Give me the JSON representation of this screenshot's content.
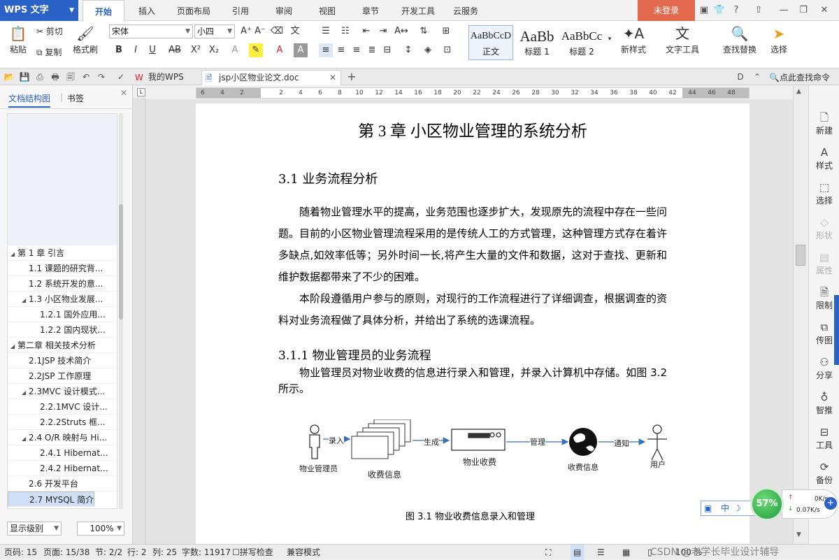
{
  "app": {
    "logo": "WPS 文字",
    "menu_tabs": [
      "开始",
      "插入",
      "页面布局",
      "引用",
      "审阅",
      "视图",
      "章节",
      "开发工具",
      "云服务"
    ],
    "active_tab": "开始",
    "login": "未登录"
  },
  "ribbon": {
    "paste": "粘贴",
    "cut": "剪切",
    "copy": "复制",
    "format_painter": "格式刷",
    "font_name": "宋体",
    "font_size": "小四",
    "styles": [
      {
        "sample": "AaBbCcD",
        "label": "正文"
      },
      {
        "sample": "AaBb",
        "label": "标题 1"
      },
      {
        "sample": "AaBbCc",
        "label": "标题 2"
      }
    ],
    "new_style": "新样式",
    "text_tools": "文字工具",
    "find_replace": "查找替换",
    "select": "选择"
  },
  "tabs": {
    "home_tab": "我的WPS",
    "doc_tab": "jsp小区物业论文.doc",
    "search_cmd": "点此查找命令"
  },
  "nav": {
    "tab_outline": "文档结构图",
    "tab_bookmark": "书签",
    "items": [
      {
        "label": "第 1 章  引言",
        "level": 0,
        "toggle": "◢"
      },
      {
        "label": "1.1 课题的研究背...",
        "level": 1,
        "toggle": ""
      },
      {
        "label": "1.2  系统开发的意...",
        "level": 1,
        "toggle": ""
      },
      {
        "label": "1.3  小区物业发展...",
        "level": 1,
        "toggle": "◢"
      },
      {
        "label": "1.2.1  国外应用...",
        "level": 2,
        "toggle": ""
      },
      {
        "label": "1.2.2 国内现状...",
        "level": 2,
        "toggle": ""
      },
      {
        "label": "第二章  相关技术分析",
        "level": 0,
        "toggle": "◢"
      },
      {
        "label": "2.1JSP 技术简介",
        "level": 1,
        "toggle": ""
      },
      {
        "label": "2.2JSP 工作原理",
        "level": 1,
        "toggle": ""
      },
      {
        "label": "2.3MVC  设计模式...",
        "level": 1,
        "toggle": "◢"
      },
      {
        "label": "2.2.1MVC  设计...",
        "level": 2,
        "toggle": ""
      },
      {
        "label": "2.2.2Struts 框...",
        "level": 2,
        "toggle": ""
      },
      {
        "label": "2.4 O/R 映射与 Hi...",
        "level": 1,
        "toggle": "◢"
      },
      {
        "label": "2.4.1 Hibernat...",
        "level": 2,
        "toggle": ""
      },
      {
        "label": "2.4.2 Hibernat...",
        "level": 2,
        "toggle": ""
      },
      {
        "label": "2.6  开发平台",
        "level": 1,
        "toggle": ""
      },
      {
        "label": "2.7 MYSQL 简介",
        "level": 1,
        "toggle": "",
        "selected": true
      }
    ],
    "level_select": "显示级别",
    "zoom_select": "100%"
  },
  "ruler": [
    "6",
    "4",
    "2",
    "",
    "2",
    "4",
    "6",
    "8",
    "10",
    "12",
    "14",
    "16",
    "18",
    "20",
    "22",
    "24",
    "26",
    "28",
    "30",
    "32",
    "34",
    "36",
    "38",
    "40",
    "42",
    "44",
    "46",
    "48"
  ],
  "document": {
    "chapter_title": "第 3 章  小区物业管理的系统分析",
    "h_31": "3.1 业务流程分析",
    "p1": "随着物业管理水平的提高，业务范围也逐步扩大，发现原先的流程中存在一些问题。目前的小区物业管理流程采用的是传统人工的方式管理，这种管理方式存在着许多缺点,如效率低等；另外时间一长,将产生大量的文件和数据，这对于查找、更新和维护数据都带来了不少的困难。",
    "p2": "本阶段遵循用户参与的原则，对现行的工作流程进行了详细调查，根据调查的资料对业务流程做了具体分析，并给出了系统的选课流程。",
    "h_311": "3.1.1 物业管理员的业务流程",
    "p3": "物业管理员对物业收费的信息进行录入和管理，并录入计算机中存储。如图 3.2 所示。",
    "diagram": {
      "actor1": "物业管理员",
      "edge1": "录入",
      "node1": "收费信息",
      "edge2": "生成",
      "node2": "物业收费",
      "edge3": "管理",
      "node3": "收费信息",
      "edge4": "通知",
      "actor2": "用户"
    },
    "caption": "图 3.1 物业收费信息录入和管理"
  },
  "right_sidebar": [
    {
      "label": "新建",
      "icon": "new-doc-icon",
      "glyph": "🗋",
      "disabled": false
    },
    {
      "label": "样式",
      "icon": "style-icon",
      "glyph": "A",
      "disabled": false
    },
    {
      "label": "选择",
      "icon": "select-icon",
      "glyph": "⬚",
      "disabled": false
    },
    {
      "label": "形状",
      "icon": "shape-icon",
      "glyph": "◇",
      "disabled": true
    },
    {
      "label": "属性",
      "icon": "properties-icon",
      "glyph": "▤",
      "disabled": true
    },
    {
      "label": "限制",
      "icon": "restrict-icon",
      "glyph": "🗎",
      "disabled": false
    },
    {
      "label": "传图",
      "icon": "upload-image-icon",
      "glyph": "⧉",
      "disabled": false
    },
    {
      "label": "分享",
      "icon": "share-icon",
      "glyph": "⚇",
      "disabled": false
    },
    {
      "label": "智推",
      "icon": "smart-push-icon",
      "glyph": "♁",
      "disabled": false
    },
    {
      "label": "工具",
      "icon": "toolbox-icon",
      "glyph": "⊟",
      "disabled": false
    },
    {
      "label": "备份",
      "icon": "backup-icon",
      "glyph": "⟳",
      "disabled": false
    }
  ],
  "status": {
    "page_code": "页码: 15",
    "page": "页面: 15/38",
    "section": "节: 2/2",
    "row": "行: 2",
    "col": "列: 25",
    "words": "字数: 11917",
    "spell": "拼写检查",
    "compat": "兼容模式",
    "zoom": "100 %",
    "watermark": "CSDN @老学长毕业设计辅导"
  },
  "overlay": {
    "ime_mode": "中",
    "usage": "57%",
    "up_speed": "0K/s",
    "down_speed": "0.07K/s"
  },
  "colors": {
    "brand": "#2b62c7",
    "login": "#e46a4f",
    "selected_nav": "#cfe0f6"
  }
}
